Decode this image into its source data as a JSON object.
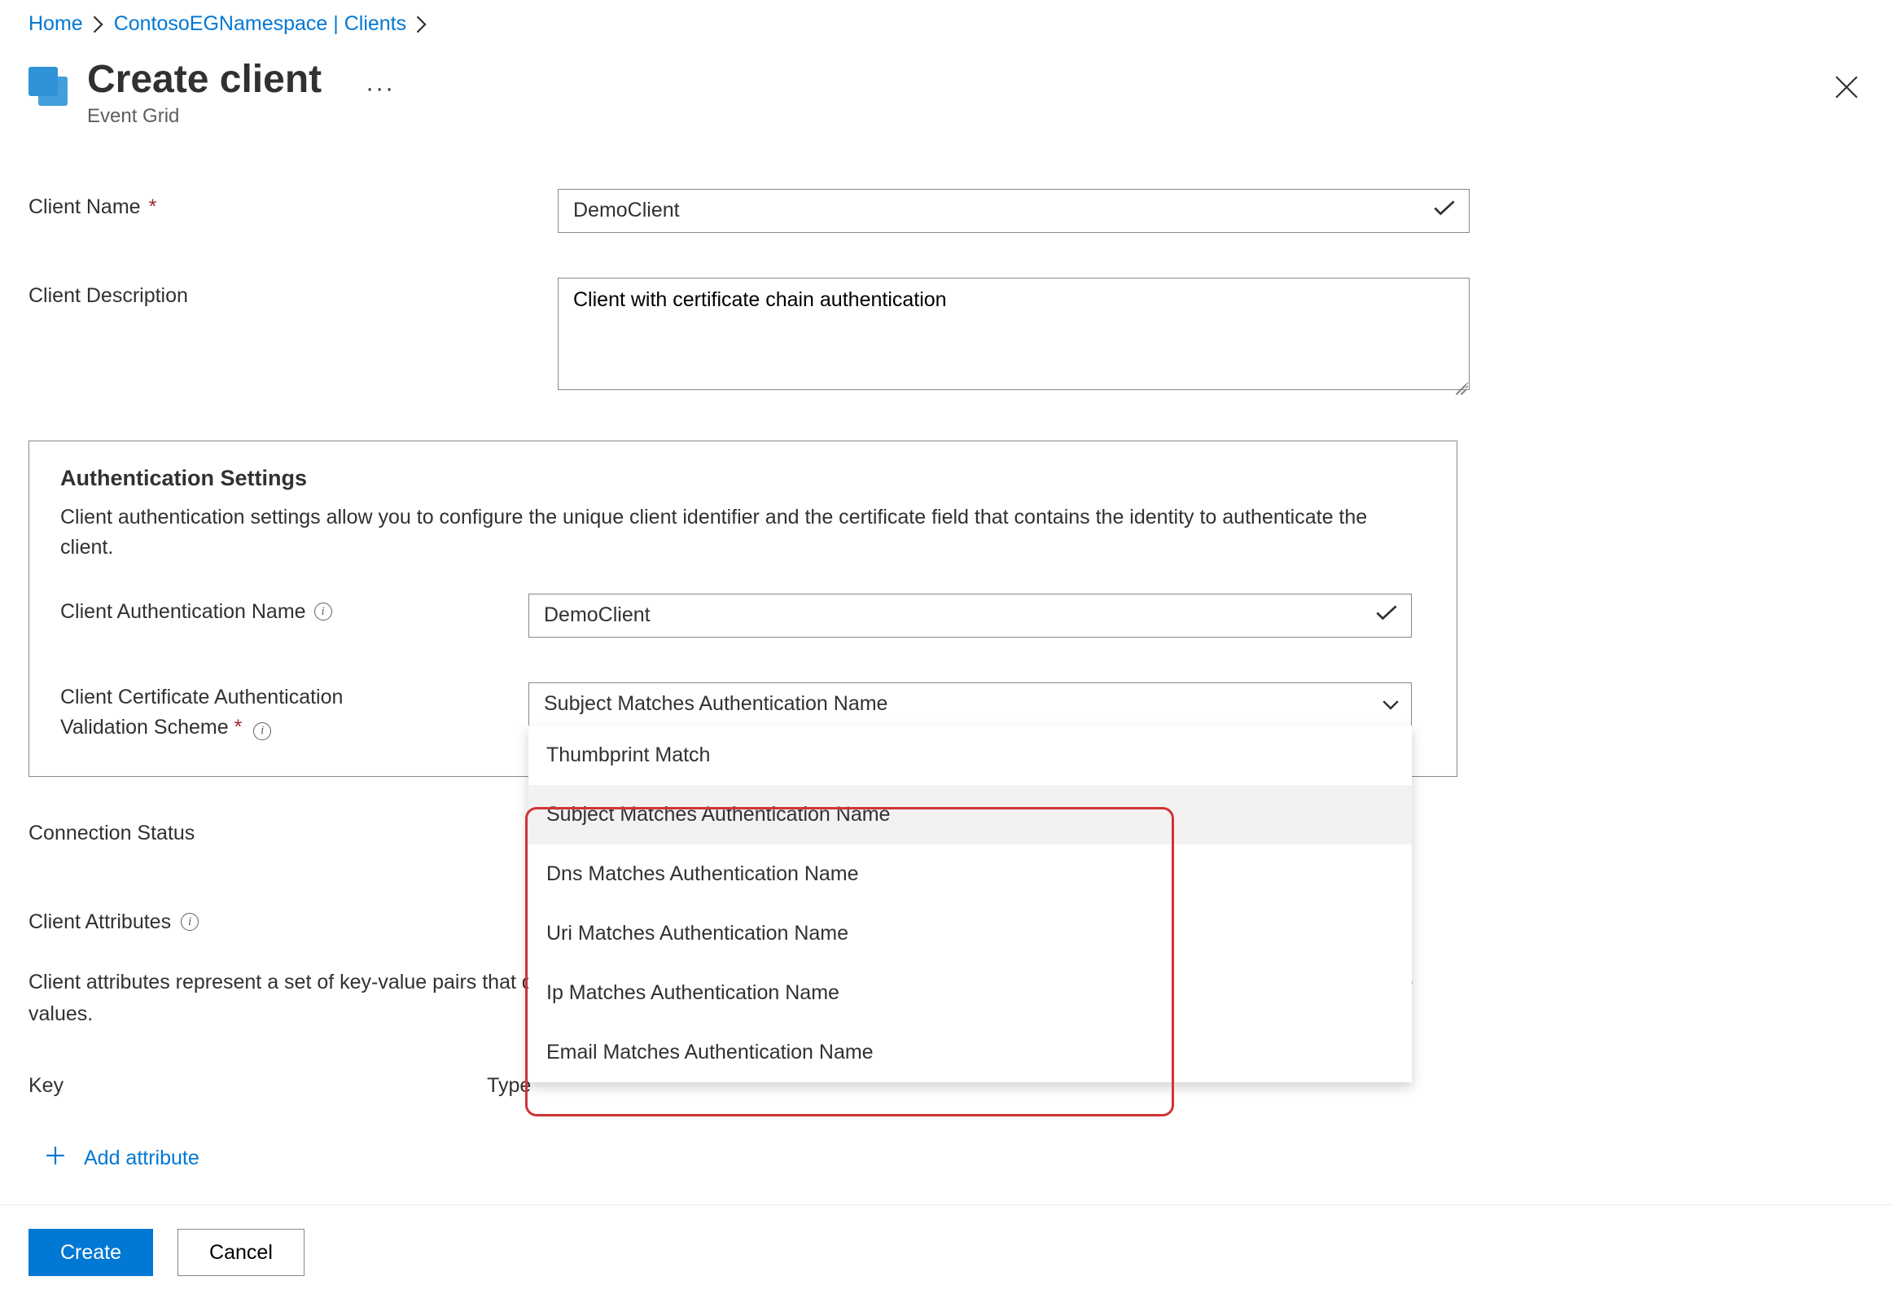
{
  "breadcrumb": {
    "home": "Home",
    "namespace": "ContosoEGNamespace | Clients"
  },
  "header": {
    "title": "Create client",
    "subtitle": "Event Grid"
  },
  "form": {
    "clientName": {
      "label": "Client Name",
      "value": "DemoClient"
    },
    "clientDesc": {
      "label": "Client Description",
      "value": "Client with certificate chain authentication"
    }
  },
  "auth": {
    "sectionTitle": "Authentication Settings",
    "sectionDesc": "Client authentication settings allow you to configure the unique client identifier and the certificate field that contains the identity to authenticate the client.",
    "authName": {
      "label": "Client Authentication Name",
      "value": "DemoClient"
    },
    "validationScheme": {
      "label1": "Client Certificate Authentication",
      "label2": "Validation Scheme",
      "selected": "Subject Matches Authentication Name",
      "options": [
        "Thumbprint Match",
        "Subject Matches Authentication Name",
        "Dns Matches Authentication Name",
        "Uri Matches Authentication Name",
        "Ip Matches Authentication Name",
        "Email Matches Authentication Name"
      ]
    }
  },
  "later": {
    "connStatus": "Connection Status",
    "clientAttrs": "Client Attributes",
    "attrDesc": "Client attributes represent a set of key-value pairs that describe the client. These attributes help group together a set of clients based on common attribute values.",
    "keyHdr": "Key",
    "typeHdr": "Type",
    "addAttr": "Add attribute"
  },
  "footer": {
    "create": "Create",
    "cancel": "Cancel"
  }
}
